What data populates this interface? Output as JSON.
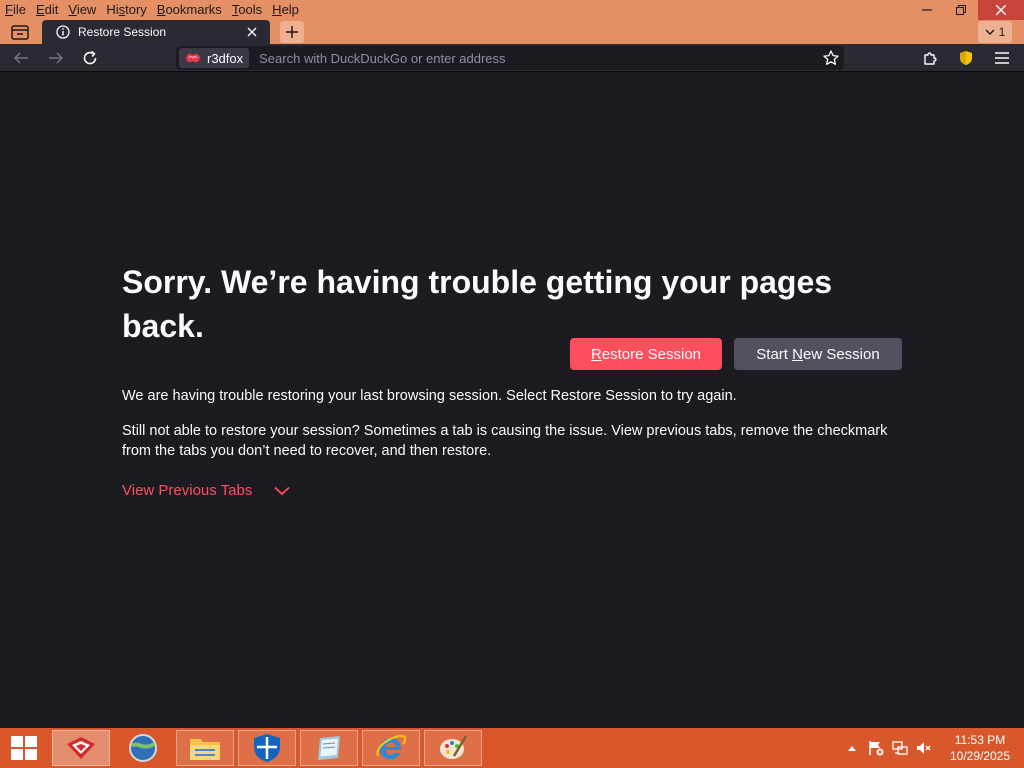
{
  "menubar": {
    "items": [
      "File",
      "Edit",
      "View",
      "History",
      "Bookmarks",
      "Tools",
      "Help"
    ]
  },
  "window_controls": {
    "minimize_icon": "minimize-icon",
    "restore_icon": "restore-icon",
    "close_icon": "close-icon"
  },
  "tabs": {
    "active_tab_title": "Restore Session",
    "tab_count": "1"
  },
  "navbar": {
    "identity_label": "r3dfox",
    "url_placeholder": "Search with DuckDuckGo or enter address"
  },
  "page": {
    "title": "Sorry. We’re having trouble getting your pages back.",
    "paragraph_1": "We are having trouble restoring your last browsing session. Select Restore Session to try again.",
    "paragraph_2": "Still not able to restore your session? Sometimes a tab is causing the issue. View previous tabs, remove the checkmark from the tabs you don’t need to recover, and then restore.",
    "view_previous_tabs": "View Previous Tabs",
    "restore_button": {
      "underlined": "R",
      "rest": "estore Session"
    },
    "new_session_button": {
      "before": "Start ",
      "underlined": "N",
      "after": "ew Session"
    }
  },
  "colors": {
    "titlebar": "#e58f64",
    "toolbar": "#2b2a33",
    "page_background": "#1c1b22",
    "accent": "#ff4f5e",
    "secondary_button": "#52525e",
    "taskbar": "#d9582b"
  },
  "taskbar": {
    "apps": [
      "r3dfox-icon",
      "browser-globe-icon",
      "file-explorer-icon",
      "security-shield-icon",
      "notepad-icon",
      "internet-explorer-icon",
      "paint-icon"
    ],
    "clock_time": "11:53 PM",
    "clock_date": "10/29/2025"
  }
}
